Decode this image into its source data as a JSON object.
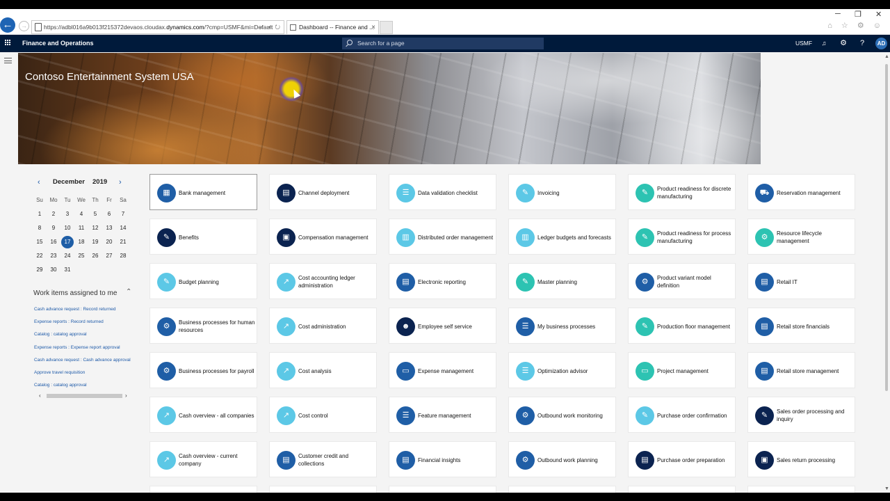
{
  "browser": {
    "url_prefix": "https://adbl016a9b013f215372devaos.cloudax.",
    "url_domain": "dynamics.com",
    "url_suffix": "/?cmp=USMF&mi=Default",
    "url_controls": "⌕ ▾ ↻",
    "tab_title": "Dashboard -- Finance and ...",
    "tab_close": "×",
    "back_icon": "back-arrow-icon",
    "forward_icon": "forward-arrow-icon",
    "window_min": "─",
    "window_restore": "❐",
    "window_close": "✕",
    "toolbar_icons": "⌂ ☆ ⚙ ☺"
  },
  "navbar": {
    "app_name": "Finance and Operations",
    "search_placeholder": "Search for a page",
    "company": "USMF",
    "bell": "🔔",
    "gear": "⚙",
    "help": "?",
    "avatar": "AD",
    "bg_color": "#001a3b"
  },
  "banner": {
    "title": "Contoso Entertainment System USA"
  },
  "calendar": {
    "prev": "‹",
    "next": "›",
    "month": "December",
    "year": "2019",
    "dow": [
      "Su",
      "Mo",
      "Tu",
      "We",
      "Th",
      "Fr",
      "Sa"
    ],
    "weeks": [
      [
        "1",
        "2",
        "3",
        "4",
        "5",
        "6",
        "7"
      ],
      [
        "8",
        "9",
        "10",
        "11",
        "12",
        "13",
        "14"
      ],
      [
        "15",
        "16",
        "17",
        "18",
        "19",
        "20",
        "21"
      ],
      [
        "22",
        "23",
        "24",
        "25",
        "26",
        "27",
        "28"
      ],
      [
        "29",
        "30",
        "31",
        "",
        "",
        "",
        ""
      ]
    ],
    "selected": "17",
    "selected_color": "#1f5ea6"
  },
  "work_items": {
    "title": "Work items assigned to me",
    "collapse_icon": "chevron-up-icon",
    "items": [
      "Cash advance request : Record returned",
      "Expense reports : Record returned",
      "Catalog : catalog approval",
      "Expense reports : Expense report approval",
      "Cash advance request : Cash advance approval",
      "Approve travel requisition",
      "Catalog : catalog approval"
    ],
    "scroll_left": "‹",
    "scroll_right": "›"
  },
  "tiles": [
    [
      {
        "label": "Bank management",
        "color": "#1f5ea6",
        "icon": "bank-icon",
        "glyph": "▦"
      },
      {
        "label": "Benefits",
        "color": "#0b2350",
        "icon": "benefits-icon",
        "glyph": "✎"
      },
      {
        "label": "Budget planning",
        "color": "#5cc8e6",
        "icon": "budget-icon",
        "glyph": "✎"
      },
      {
        "label": "Business processes for human resources",
        "color": "#1f5ea6",
        "icon": "process-icon",
        "glyph": "⚙"
      },
      {
        "label": "Business processes for payroll",
        "color": "#1f5ea6",
        "icon": "process-icon",
        "glyph": "⚙"
      },
      {
        "label": "Cash overview - all companies",
        "color": "#5cc8e6",
        "icon": "trend-icon",
        "glyph": "↗"
      },
      {
        "label": "Cash overview - current company",
        "color": "#5cc8e6",
        "icon": "trend-icon",
        "glyph": "↗"
      }
    ],
    [
      {
        "label": "Channel deployment",
        "color": "#0b2350",
        "icon": "channel-icon",
        "glyph": "▤"
      },
      {
        "label": "Compensation management",
        "color": "#0b2350",
        "icon": "compensation-icon",
        "glyph": "▣"
      },
      {
        "label": "Cost accounting ledger administration",
        "color": "#5cc8e6",
        "icon": "trend-icon",
        "glyph": "↗"
      },
      {
        "label": "Cost administration",
        "color": "#5cc8e6",
        "icon": "trend-icon",
        "glyph": "↗"
      },
      {
        "label": "Cost analysis",
        "color": "#5cc8e6",
        "icon": "trend-icon",
        "glyph": "↗"
      },
      {
        "label": "Cost control",
        "color": "#5cc8e6",
        "icon": "trend-icon",
        "glyph": "↗"
      },
      {
        "label": "Customer credit and collections",
        "color": "#1f5ea6",
        "icon": "credit-icon",
        "glyph": "▤"
      }
    ],
    [
      {
        "label": "Data validation checklist",
        "color": "#5cc8e6",
        "icon": "checklist-icon",
        "glyph": "☰"
      },
      {
        "label": "Distributed order management",
        "color": "#5cc8e6",
        "icon": "order-icon",
        "glyph": "▥"
      },
      {
        "label": "Electronic reporting",
        "color": "#1f5ea6",
        "icon": "report-icon",
        "glyph": "▤"
      },
      {
        "label": "Employee self service",
        "color": "#0b2350",
        "icon": "employee-icon",
        "glyph": "☻"
      },
      {
        "label": "Expense management",
        "color": "#1f5ea6",
        "icon": "expense-icon",
        "glyph": "▭"
      },
      {
        "label": "Feature management",
        "color": "#1f5ea6",
        "icon": "feature-icon",
        "glyph": "☰"
      },
      {
        "label": "Financial insights",
        "color": "#1f5ea6",
        "icon": "insights-icon",
        "glyph": "▤"
      }
    ],
    [
      {
        "label": "Invoicing",
        "color": "#5cc8e6",
        "icon": "invoice-icon",
        "glyph": "✎"
      },
      {
        "label": "Ledger budgets and forecasts",
        "color": "#5cc8e6",
        "icon": "ledger-icon",
        "glyph": "▥"
      },
      {
        "label": "Master planning",
        "color": "#2dc3b2",
        "icon": "planning-icon",
        "glyph": "✎"
      },
      {
        "label": "My business processes",
        "color": "#1f5ea6",
        "icon": "my-process-icon",
        "glyph": "☰"
      },
      {
        "label": "Optimization advisor",
        "color": "#5cc8e6",
        "icon": "advisor-icon",
        "glyph": "☰"
      },
      {
        "label": "Outbound work monitoring",
        "color": "#1f5ea6",
        "icon": "outbound-icon",
        "glyph": "⚙"
      },
      {
        "label": "Outbound work planning",
        "color": "#1f5ea6",
        "icon": "outbound-icon",
        "glyph": "⚙"
      }
    ],
    [
      {
        "label": "Product readiness for discrete manufacturing",
        "color": "#2dc3b2",
        "icon": "product-icon",
        "glyph": "✎"
      },
      {
        "label": "Product readiness for process manufacturing",
        "color": "#2dc3b2",
        "icon": "product-icon",
        "glyph": "✎"
      },
      {
        "label": "Product variant model definition",
        "color": "#1f5ea6",
        "icon": "variant-icon",
        "glyph": "⚙"
      },
      {
        "label": "Production floor management",
        "color": "#2dc3b2",
        "icon": "production-icon",
        "glyph": "✎"
      },
      {
        "label": "Project management",
        "color": "#2dc3b2",
        "icon": "project-icon",
        "glyph": "▭"
      },
      {
        "label": "Purchase order confirmation",
        "color": "#5cc8e6",
        "icon": "purchase-icon",
        "glyph": "✎"
      },
      {
        "label": "Purchase order preparation",
        "color": "#0b2350",
        "icon": "purchase-icon",
        "glyph": "▤"
      }
    ],
    [
      {
        "label": "Reservation management",
        "color": "#1f5ea6",
        "icon": "reservation-icon",
        "glyph": "⛟"
      },
      {
        "label": "Resource lifecycle management",
        "color": "#2dc3b2",
        "icon": "resource-icon",
        "glyph": "⚙"
      },
      {
        "label": "Retail IT",
        "color": "#1f5ea6",
        "icon": "retail-icon",
        "glyph": "▤"
      },
      {
        "label": "Retail store financials",
        "color": "#1f5ea6",
        "icon": "store-icon",
        "glyph": "▤"
      },
      {
        "label": "Retail store management",
        "color": "#1f5ea6",
        "icon": "store-icon",
        "glyph": "▤"
      },
      {
        "label": "Sales order processing and inquiry",
        "color": "#0b2350",
        "icon": "sales-icon",
        "glyph": "✎"
      },
      {
        "label": "Sales return processing",
        "color": "#0b2350",
        "icon": "return-icon",
        "glyph": "▣"
      }
    ]
  ]
}
